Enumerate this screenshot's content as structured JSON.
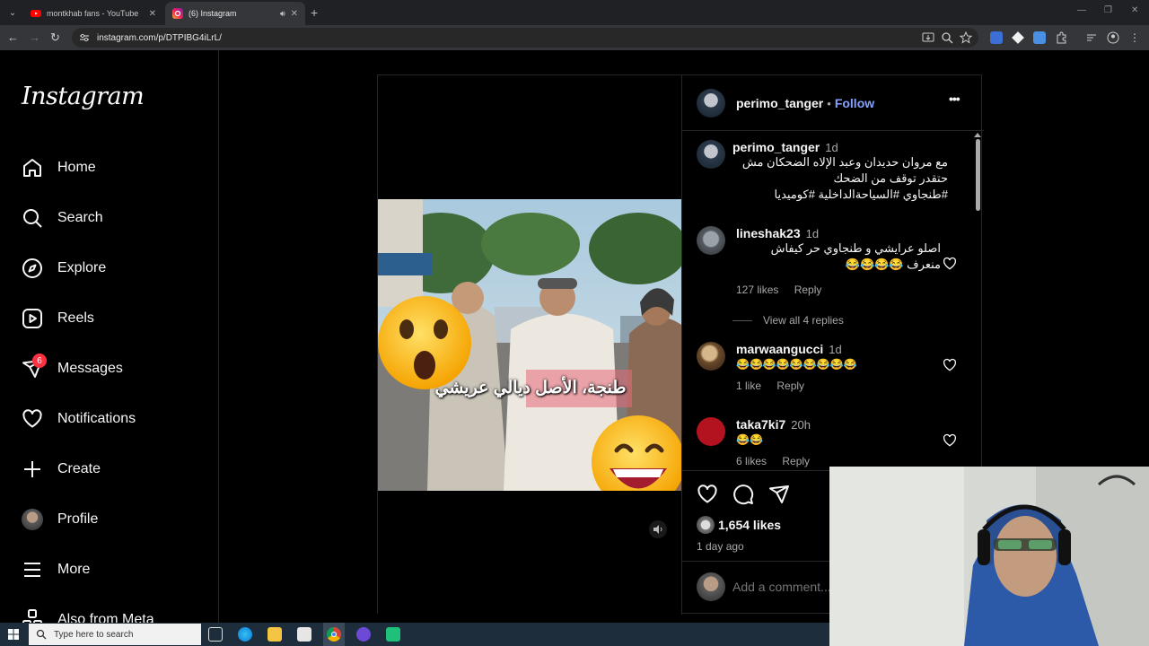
{
  "browser": {
    "tabs": [
      {
        "title": "montkhab fans - YouTube",
        "active": false
      },
      {
        "title": "(6) Instagram",
        "active": true
      }
    ],
    "url": "instagram.com/p/DTPIBG4iLrL/"
  },
  "sidebar": {
    "logo": "Instagram",
    "items": [
      {
        "label": "Home",
        "icon": "home-icon"
      },
      {
        "label": "Search",
        "icon": "search-icon"
      },
      {
        "label": "Explore",
        "icon": "compass-icon"
      },
      {
        "label": "Reels",
        "icon": "reels-icon"
      },
      {
        "label": "Messages",
        "icon": "messenger-icon",
        "badge": "6"
      },
      {
        "label": "Notifications",
        "icon": "heart-icon"
      },
      {
        "label": "Create",
        "icon": "plus-icon"
      },
      {
        "label": "Profile",
        "icon": "avatar"
      },
      {
        "label": "More",
        "icon": "menu-icon"
      },
      {
        "label": "Also from Meta",
        "icon": "meta-icon"
      }
    ]
  },
  "post": {
    "video_caption": "طنجة، الأصل ديالي عريشي",
    "author": "perimo_tanger",
    "follow": "Follow",
    "more": "•••",
    "caption": {
      "user": "perimo_tanger",
      "time": "1d",
      "line1": "مع مروان حديدان وعبد الإلاه الضحكان مش",
      "line2": "حتقدر توقف من الضحك",
      "hashtags": "#طنجاوي #السياحةالداخلية #كوميديا"
    },
    "comments": [
      {
        "user": "lineshak23",
        "time": "1d",
        "text1": "اصلو عرايشي و طنجاوي حر كيفاش",
        "text2": "منعرف 😂😂😂😂",
        "likes": "127 likes",
        "reply": "Reply",
        "view_replies": "View all 4 replies"
      },
      {
        "user": "marwaangucci",
        "time": "1d",
        "text1": "😂😂😂😂😂😂😂😂😂",
        "likes": "1 like",
        "reply": "Reply"
      },
      {
        "user": "taka7ki7",
        "time": "20h",
        "text1": "😂😂",
        "likes": "6 likes",
        "reply": "Reply"
      }
    ],
    "likes": "1,654 likes",
    "posted": "1 day ago",
    "add_comment_placeholder": "Add a comment..."
  },
  "taskbar": {
    "search_placeholder": "Type here to search"
  }
}
